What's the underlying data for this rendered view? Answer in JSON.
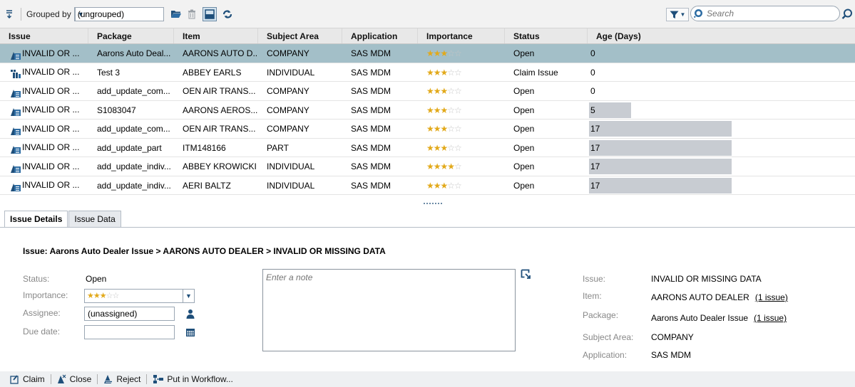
{
  "toolbar": {
    "grouped_by_label": "Grouped by",
    "grouped_by_value": "(ungrouped)",
    "search_placeholder": "Search"
  },
  "grid": {
    "columns": [
      "Issue",
      "Package",
      "Item",
      "Subject Area",
      "Application",
      "Importance",
      "Status",
      "Age (Days)"
    ],
    "rows": [
      {
        "issue": "INVALID OR ...",
        "package": "Aarons Auto Deal...",
        "item": "AARONS AUTO D...",
        "subject": "COMPANY",
        "app": "SAS MDM",
        "stars": 3,
        "status": "Open",
        "age": "0",
        "age_days": 0,
        "icon": "workflow-issue-icon"
      },
      {
        "issue": "INVALID OR ...",
        "package": "Test 3",
        "item": "ABBEY EARLS",
        "subject": "INDIVIDUAL",
        "app": "SAS MDM",
        "stars": 3,
        "status": "Claim Issue",
        "age": "0",
        "age_days": 0,
        "icon": "claimed-issue-icon"
      },
      {
        "issue": "INVALID OR ...",
        "package": "add_update_com...",
        "item": "OEN AIR TRANS...",
        "subject": "COMPANY",
        "app": "SAS MDM",
        "stars": 3,
        "status": "Open",
        "age": "0",
        "age_days": 0,
        "icon": "workflow-issue-icon"
      },
      {
        "issue": "INVALID OR ...",
        "package": "S1083047",
        "item": "AARONS AEROS...",
        "subject": "COMPANY",
        "app": "SAS MDM",
        "stars": 3,
        "status": "Open",
        "age": "5",
        "age_days": 5,
        "icon": "workflow-issue-icon"
      },
      {
        "issue": "INVALID OR ...",
        "package": "add_update_com...",
        "item": "OEN AIR TRANS...",
        "subject": "COMPANY",
        "app": "SAS MDM",
        "stars": 3,
        "status": "Open",
        "age": "17",
        "age_days": 17,
        "icon": "workflow-issue-icon"
      },
      {
        "issue": "INVALID OR ...",
        "package": "add_update_part",
        "item": "ITM148166",
        "subject": "PART",
        "app": "SAS MDM",
        "stars": 3,
        "status": "Open",
        "age": "17",
        "age_days": 17,
        "icon": "workflow-issue-icon"
      },
      {
        "issue": "INVALID OR ...",
        "package": "add_update_indiv...",
        "item": "ABBEY KROWICKI",
        "subject": "INDIVIDUAL",
        "app": "SAS MDM",
        "stars": 4,
        "status": "Open",
        "age": "17",
        "age_days": 17,
        "icon": "workflow-issue-icon"
      },
      {
        "issue": "INVALID OR ...",
        "package": "add_update_indiv...",
        "item": "AERI BALTZ",
        "subject": "INDIVIDUAL",
        "app": "SAS MDM",
        "stars": 3,
        "status": "Open",
        "age": "17",
        "age_days": 17,
        "icon": "workflow-issue-icon"
      }
    ],
    "selected_index": 0,
    "max_age_days": 17
  },
  "tabs": [
    {
      "label": "Issue Details",
      "active": true
    },
    {
      "label": "Issue Data",
      "active": false
    }
  ],
  "details": {
    "title": "Issue:  Aarons Auto Dealer Issue > AARONS AUTO DEALER > INVALID OR MISSING DATA",
    "status_label": "Status:",
    "status_value": "Open",
    "importance_label": "Importance:",
    "importance_stars": 3,
    "assignee_label": "Assignee:",
    "assignee_value": "(unassigned)",
    "due_date_label": "Due date:",
    "due_date_value": "",
    "note_placeholder": "Enter a note",
    "issue_label": "Issue:",
    "issue_value": "INVALID OR MISSING DATA",
    "item_label": "Item:",
    "item_value": "AARONS AUTO DEALER",
    "item_link": "(1 issue)",
    "package_label": "Package:",
    "package_value": "Aarons Auto Dealer Issue",
    "package_link": "(1 issue)",
    "subject_label": "Subject Area:",
    "subject_value": "COMPANY",
    "application_label": "Application:",
    "application_value": "SAS MDM"
  },
  "actions": {
    "claim": "Claim",
    "close": "Close",
    "reject": "Reject",
    "workflow": "Put in Workflow..."
  },
  "colors": {
    "selected_row": "#a3bfc8",
    "star_on": "#e2a91a",
    "age_bar": "#c8ccd2",
    "icon_blue": "#1f4f7a"
  }
}
